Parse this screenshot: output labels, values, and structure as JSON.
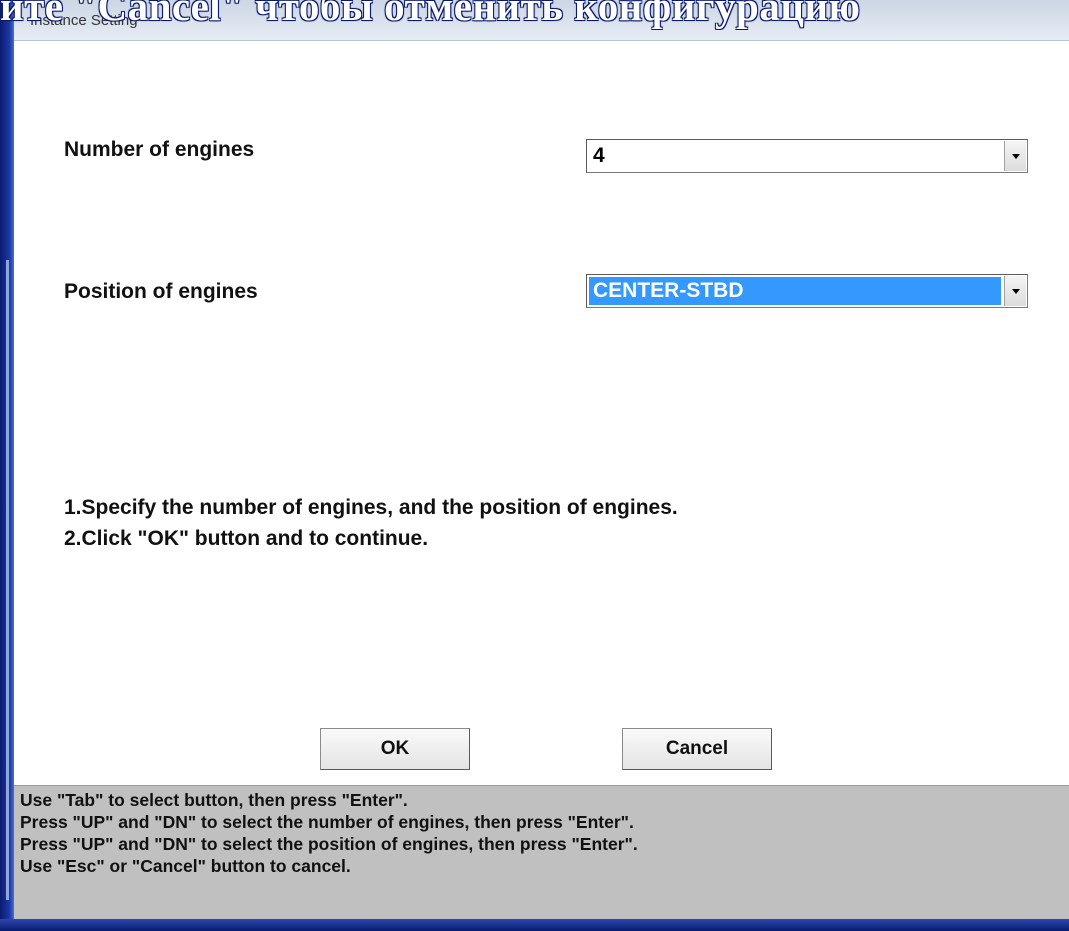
{
  "slide": {
    "heading": "ите \"Cancel\" чтобы отменить конфигурацию"
  },
  "window": {
    "title": "Instance Setting"
  },
  "form": {
    "engines_count": {
      "label": "Number of engines",
      "value": "4"
    },
    "engines_position": {
      "label": "Position of engines",
      "value": "CENTER-STBD"
    }
  },
  "instructions": [
    "1.Specify the number of engines, and the position of engines.",
    "2.Click \"OK\" button and to continue."
  ],
  "buttons": {
    "ok": "OK",
    "cancel": "Cancel"
  },
  "help": [
    "Use \"Tab\" to select button, then press \"Enter\".",
    "Press \"UP\" and \"DN\" to select the number of engines, then press \"Enter\".",
    "Press \"UP\" and \"DN\" to select the position of engines, then press \"Enter\".",
    "Use \"Esc\" or \"Cancel\" button to cancel."
  ],
  "colors": {
    "selection": "#3399ff",
    "help_panel": "#c0c0c0",
    "slide_background": "#1c3aa8"
  }
}
